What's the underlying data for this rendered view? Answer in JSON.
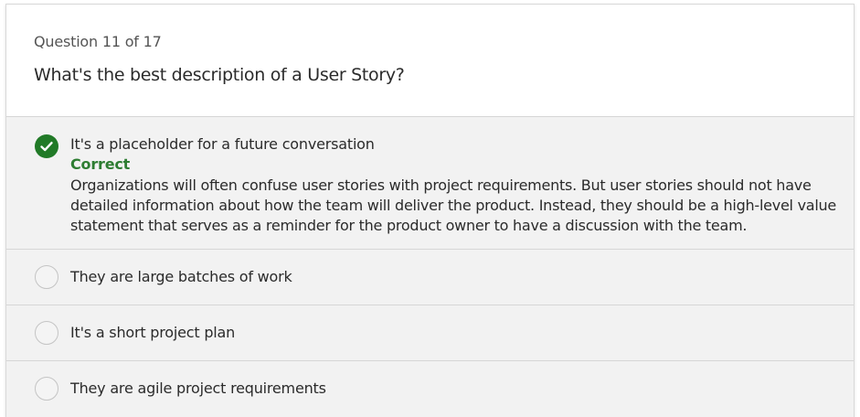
{
  "question": {
    "counter": "Question 11 of 17",
    "text": "What's the best description of a User Story?"
  },
  "answers": [
    {
      "label": "It's a placeholder for a future conversation",
      "selected": true,
      "status": "Correct",
      "explanation": "Organizations will often confuse user stories with project requirements. But user stories should not have detailed information about how the team will deliver the product. Instead, they should be a high-level value statement that serves as a reminder for the product owner to have a discussion with the team."
    },
    {
      "label": "They are large batches of work",
      "selected": false
    },
    {
      "label": "It's a short project plan",
      "selected": false
    },
    {
      "label": "They are agile project requirements",
      "selected": false
    }
  ],
  "colors": {
    "correct_green": "#2e7d32",
    "check_circle": "#217a27",
    "answers_bg": "#f2f2f2"
  },
  "icons": {
    "selected_answer": "checkmark-circle-icon",
    "unselected_answer": "radio-empty-icon"
  }
}
